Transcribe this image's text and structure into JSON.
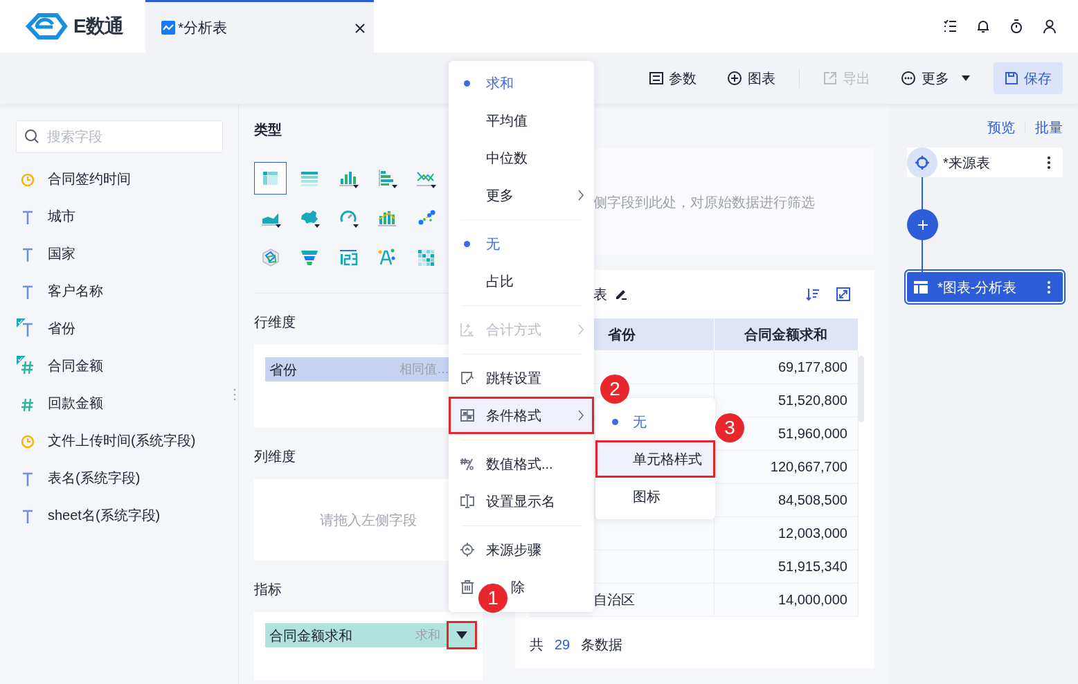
{
  "app": {
    "name": "E数通"
  },
  "tabs": [
    {
      "label": "*分析表",
      "selected": true
    }
  ],
  "toolbar": [
    {
      "label": "参数",
      "kind": "button",
      "disabled": false
    },
    {
      "label": "图表",
      "kind": "button",
      "disabled": false
    },
    {
      "label": "导出",
      "kind": "button",
      "disabled": true
    },
    {
      "label": "更多",
      "kind": "dropdown",
      "disabled": false
    },
    {
      "label": "保存",
      "kind": "primary",
      "disabled": false
    }
  ],
  "search": {
    "placeholder": "搜索字段"
  },
  "fields": [
    {
      "label": "合同签约时间",
      "kind": "date",
      "used": false
    },
    {
      "label": "城市",
      "kind": "text",
      "used": false
    },
    {
      "label": "国家",
      "kind": "text",
      "used": false
    },
    {
      "label": "客户名称",
      "kind": "text",
      "used": false
    },
    {
      "label": "省份",
      "kind": "text",
      "used": true
    },
    {
      "label": "合同金额",
      "kind": "number",
      "used": true
    },
    {
      "label": "回款金额",
      "kind": "number",
      "used": false
    },
    {
      "label": "文件上传时间(系统字段)",
      "kind": "date",
      "used": false
    },
    {
      "label": "表名(系统字段)",
      "kind": "text",
      "used": false
    },
    {
      "label": "sheet名(系统字段)",
      "kind": "text",
      "used": false
    }
  ],
  "chart_panel": {
    "title": "类型",
    "chart_types": [
      {
        "selected": true
      },
      {
        "selected": false
      },
      {
        "selected": false
      },
      {
        "selected": false
      },
      {
        "selected": false
      },
      {
        "selected": false
      },
      {
        "selected": false
      },
      {
        "selected": false
      },
      {
        "selected": false
      },
      {
        "selected": false
      },
      {
        "selected": false
      },
      {
        "selected": false
      },
      {
        "selected": false
      },
      {
        "selected": false
      },
      {
        "selected": false
      }
    ]
  },
  "row_dimension": {
    "title": "行维度",
    "chips": [
      {
        "label": "省份",
        "hint": "相同值…"
      }
    ]
  },
  "column_dimension": {
    "title": "列维度",
    "placeholder": "请拖入左侧字段"
  },
  "measures": {
    "title": "指标",
    "chips": [
      {
        "label": "合同金额求和",
        "aggregation": "求和"
      }
    ]
  },
  "filter": {
    "hint": "侧字段到此处，对原始数据进行筛选"
  },
  "table": {
    "title": "表",
    "columns": [
      "省份",
      "合同金额求和"
    ],
    "rows": [
      {
        "amount": "69,177,800"
      },
      {
        "amount": "51,520,800"
      },
      {
        "amount": "51,960,000"
      },
      {
        "amount": "120,667,700"
      },
      {
        "amount": "84,508,500"
      },
      {
        "amount": "12,003,000"
      },
      {
        "amount": "51,915,340"
      },
      {
        "province": "自治区",
        "amount": "14,000,000"
      }
    ],
    "footer": {
      "prefix": "共",
      "count": "29",
      "suffix": "条数据"
    }
  },
  "flow": {
    "links": [
      "预览",
      "批量"
    ],
    "nodes": [
      {
        "label": "*来源表",
        "kind": "source",
        "selected": false
      },
      {
        "kind": "add"
      },
      {
        "label": "*图表-分析表",
        "kind": "chart",
        "selected": true
      }
    ]
  },
  "menu": {
    "sections": [
      [
        {
          "label": "求和",
          "kind": "option",
          "selected": true
        },
        {
          "label": "平均值",
          "kind": "option",
          "selected": false
        },
        {
          "label": "中位数",
          "kind": "option",
          "selected": false
        },
        {
          "label": "更多",
          "kind": "submenu",
          "disabled": false
        }
      ],
      [
        {
          "label": "无",
          "kind": "option",
          "selected": true
        },
        {
          "label": "占比",
          "kind": "option",
          "selected": false
        }
      ],
      [
        {
          "label": "合计方式",
          "kind": "submenu",
          "disabled": true
        }
      ],
      [
        {
          "label": "跳转设置",
          "kind": "action"
        },
        {
          "label": "条件格式",
          "kind": "submenu",
          "disabled": false,
          "highlighted": true,
          "outlined": true
        }
      ],
      [
        {
          "label": "数值格式...",
          "kind": "action"
        },
        {
          "label": "设置显示名",
          "kind": "action"
        }
      ],
      [
        {
          "label": "来源步骤",
          "kind": "action"
        },
        {
          "label": "除",
          "kind": "action"
        }
      ]
    ]
  },
  "submenu": {
    "items": [
      {
        "label": "无",
        "selected": true,
        "highlighted": false,
        "outlined": false
      },
      {
        "label": "单元格样式",
        "selected": false,
        "highlighted": true,
        "outlined": true
      },
      {
        "label": "图标",
        "selected": false,
        "highlighted": false,
        "outlined": false
      }
    ]
  },
  "measure_dropdown": {
    "outlined": true
  },
  "callouts": [
    "1",
    "2",
    "3"
  ]
}
